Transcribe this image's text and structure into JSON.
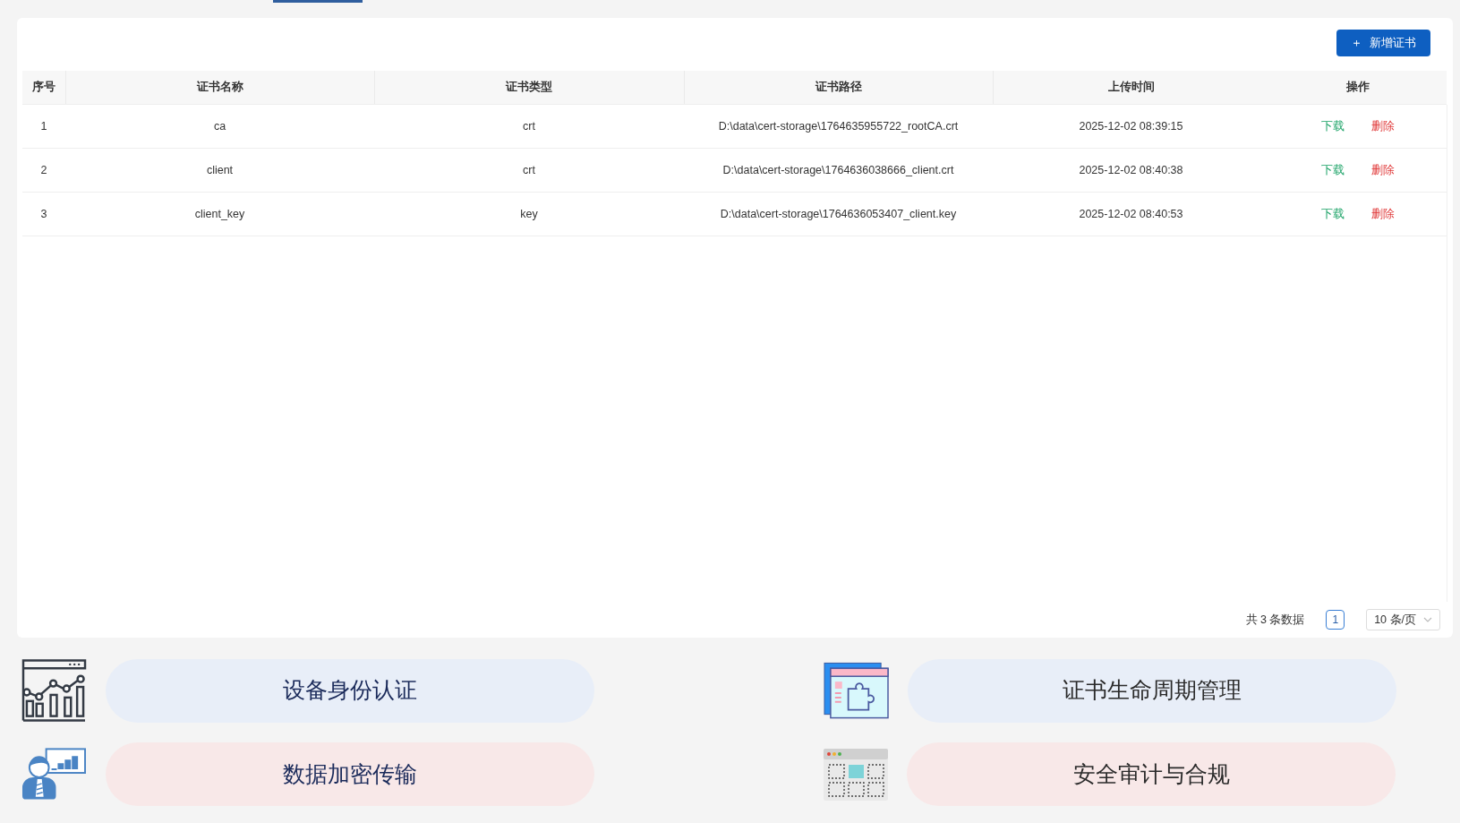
{
  "toolbar": {
    "add_button": "新增证书",
    "add_icon": "＋"
  },
  "table": {
    "columns": [
      "序号",
      "证书名称",
      "证书类型",
      "证书路径",
      "上传时间",
      "操作"
    ],
    "rows": [
      {
        "index": "1",
        "name": "ca",
        "type": "crt",
        "path": "D:\\data\\cert-storage\\1764635955722_rootCA.crt",
        "uploaded": "2025-12-02 08:39:15",
        "actions": [
          {
            "label": "下载",
            "kind": "download"
          },
          {
            "label": "删除",
            "kind": "delete"
          }
        ]
      },
      {
        "index": "2",
        "name": "client",
        "type": "crt",
        "path": "D:\\data\\cert-storage\\1764636038666_client.crt",
        "uploaded": "2025-12-02 08:40:38",
        "actions": [
          {
            "label": "下载",
            "kind": "download"
          },
          {
            "label": "删除",
            "kind": "delete"
          }
        ]
      },
      {
        "index": "3",
        "name": "client_key",
        "type": "key",
        "path": "D:\\data\\cert-storage\\1764636053407_client.key",
        "uploaded": "2025-12-02 08:40:53",
        "actions": [
          {
            "label": "下载",
            "kind": "download"
          },
          {
            "label": "删除",
            "kind": "delete"
          }
        ]
      }
    ]
  },
  "pagination": {
    "total": "共 3 条数据",
    "pages": [
      {
        "label": "1",
        "selected": true
      }
    ],
    "page_size": "10 条/页"
  },
  "features": [
    {
      "label": "设备身份认证",
      "color": "#e8eef8"
    },
    {
      "label": "证书生命周期管理",
      "color": "#e8eef8"
    },
    {
      "label": "数据加密传输",
      "color": "#f8e8e8"
    },
    {
      "label": "安全审计与合规",
      "color": "#f8e8e8"
    }
  ]
}
